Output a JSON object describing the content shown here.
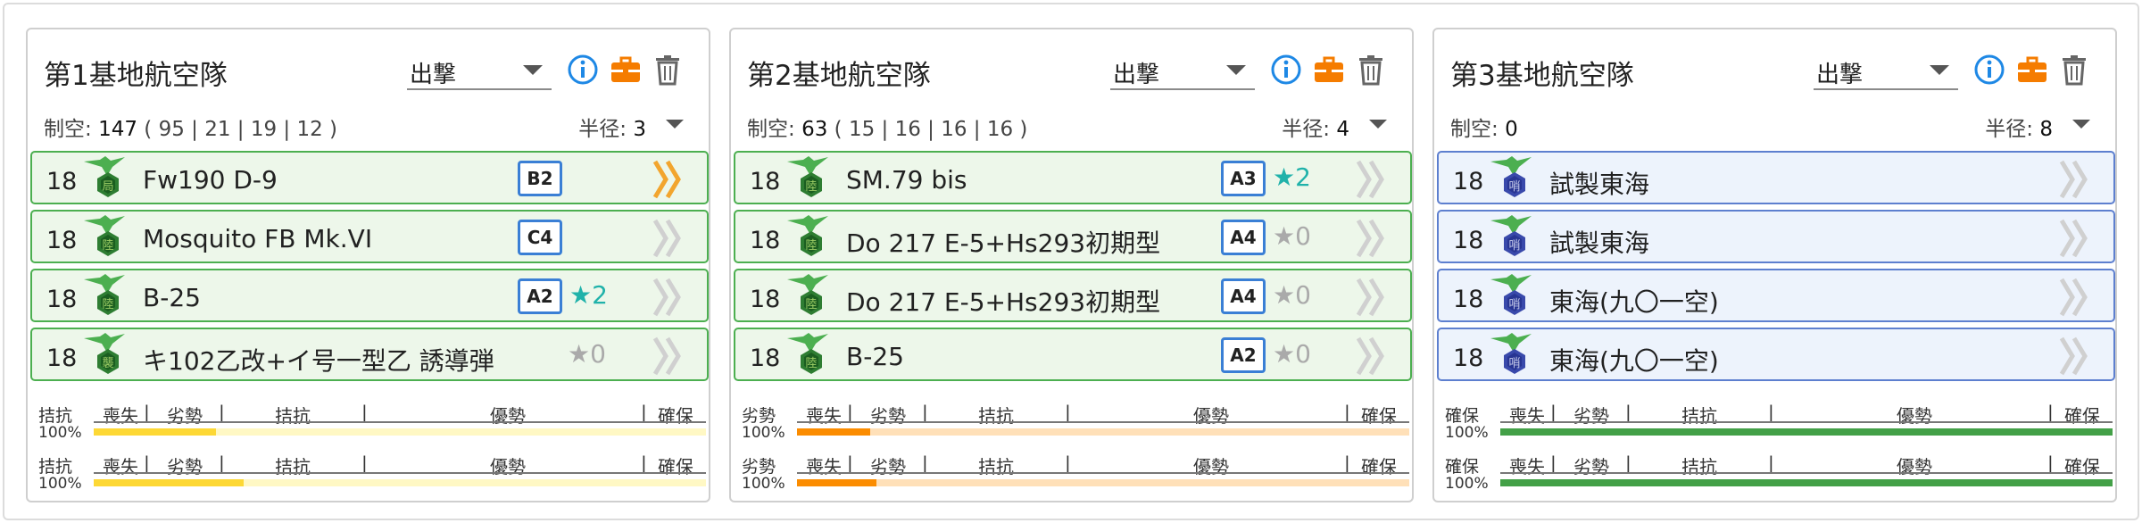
{
  "colors": {
    "row_green_border": "#4caf50",
    "row_green_bg": "#edf7ea",
    "row_blue_border": "#5d7fcf",
    "row_blue_bg": "#edf3fc",
    "badge_border": "#3a7fd5",
    "info_icon": "#1e88e5",
    "briefcase_icon": "#f57c00",
    "star_teal": "#20b2aa",
    "chevron_gold": "#f2a52e"
  },
  "scale_labels": [
    "喪失",
    "劣勢",
    "拮抗",
    "優勢",
    "確保"
  ],
  "corps": [
    {
      "title": "第1基地航空隊",
      "mode": "出撃",
      "air_label": "制空:",
      "air_value": "147",
      "air_breakdown": "( 95 | 21 | 19 | 12 )",
      "radius_label": "半径:",
      "radius_value": "3",
      "slots": [
        {
          "count": "18",
          "icon": "interceptor-plane-icon",
          "name": "Fw190 D-9",
          "improve": "B2",
          "prof": "",
          "chevron": "gold",
          "tone": "green"
        },
        {
          "count": "18",
          "icon": "army-fighter-plane-icon",
          "name": "Mosquito FB Mk.VI",
          "improve": "C4",
          "prof": "",
          "chevron": "gray",
          "tone": "green"
        },
        {
          "count": "18",
          "icon": "army-fighter-plane-icon",
          "name": "B-25",
          "improve": "A2",
          "prof": "★2",
          "prof_style": "teal",
          "chevron": "gray",
          "tone": "green"
        },
        {
          "count": "18",
          "icon": "special-attack-plane-icon",
          "name": "キ102乙改+イ号一型乙 誘導弾",
          "improve": "",
          "prof": "★0",
          "prof_style": "gray",
          "chevron": "gray",
          "tone": "green"
        }
      ],
      "bars": [
        {
          "status": "拮抗",
          "percent": "100%",
          "fill_fraction": 0.2,
          "fill_color": "#fdd835",
          "track_color": "#fff8c4"
        },
        {
          "status": "拮抗",
          "percent": "100%",
          "fill_fraction": 0.245,
          "fill_color": "#fdd835",
          "track_color": "#fff8c4"
        }
      ]
    },
    {
      "title": "第2基地航空隊",
      "mode": "出撃",
      "air_label": "制空:",
      "air_value": "63",
      "air_breakdown": "( 15 | 16 | 16 | 16 )",
      "radius_label": "半径:",
      "radius_value": "4",
      "slots": [
        {
          "count": "18",
          "icon": "army-fighter-plane-icon",
          "name": "SM.79 bis",
          "improve": "A3",
          "prof": "★2",
          "prof_style": "teal",
          "chevron": "gray",
          "tone": "green"
        },
        {
          "count": "18",
          "icon": "army-fighter-plane-icon",
          "name": "Do 217 E-5+Hs293初期型",
          "improve": "A4",
          "prof": "★0",
          "prof_style": "gray",
          "chevron": "gray",
          "tone": "green"
        },
        {
          "count": "18",
          "icon": "army-fighter-plane-icon",
          "name": "Do 217 E-5+Hs293初期型",
          "improve": "A4",
          "prof": "★0",
          "prof_style": "gray",
          "chevron": "gray",
          "tone": "green"
        },
        {
          "count": "18",
          "icon": "army-fighter-plane-icon",
          "name": "B-25",
          "improve": "A2",
          "prof": "★0",
          "prof_style": "gray",
          "chevron": "gray",
          "tone": "green"
        }
      ],
      "bars": [
        {
          "status": "劣勢",
          "percent": "100%",
          "fill_fraction": 0.12,
          "fill_color": "#fb8c00",
          "track_color": "#ffe0b8"
        },
        {
          "status": "劣勢",
          "percent": "100%",
          "fill_fraction": 0.13,
          "fill_color": "#fb8c00",
          "track_color": "#ffe0b8"
        }
      ]
    },
    {
      "title": "第3基地航空隊",
      "mode": "出撃",
      "air_label": "制空:",
      "air_value": "0",
      "air_breakdown": "",
      "radius_label": "半径:",
      "radius_value": "8",
      "slots": [
        {
          "count": "18",
          "icon": "patrol-plane-icon",
          "name": "試製東海",
          "improve": "",
          "prof": "",
          "chevron": "gray",
          "tone": "blue"
        },
        {
          "count": "18",
          "icon": "patrol-plane-icon",
          "name": "試製東海",
          "improve": "",
          "prof": "",
          "chevron": "gray",
          "tone": "blue"
        },
        {
          "count": "18",
          "icon": "patrol-plane-icon",
          "name": "東海(九〇一空)",
          "improve": "",
          "prof": "",
          "chevron": "gray",
          "tone": "blue"
        },
        {
          "count": "18",
          "icon": "patrol-plane-icon",
          "name": "東海(九〇一空)",
          "improve": "",
          "prof": "",
          "chevron": "gray",
          "tone": "blue"
        }
      ],
      "bars": [
        {
          "status": "確保",
          "percent": "100%",
          "fill_fraction": 1.0,
          "fill_color": "#43a047",
          "track_color": "#c8e6c9"
        },
        {
          "status": "確保",
          "percent": "100%",
          "fill_fraction": 1.0,
          "fill_color": "#43a047",
          "track_color": "#c8e6c9"
        }
      ]
    }
  ]
}
